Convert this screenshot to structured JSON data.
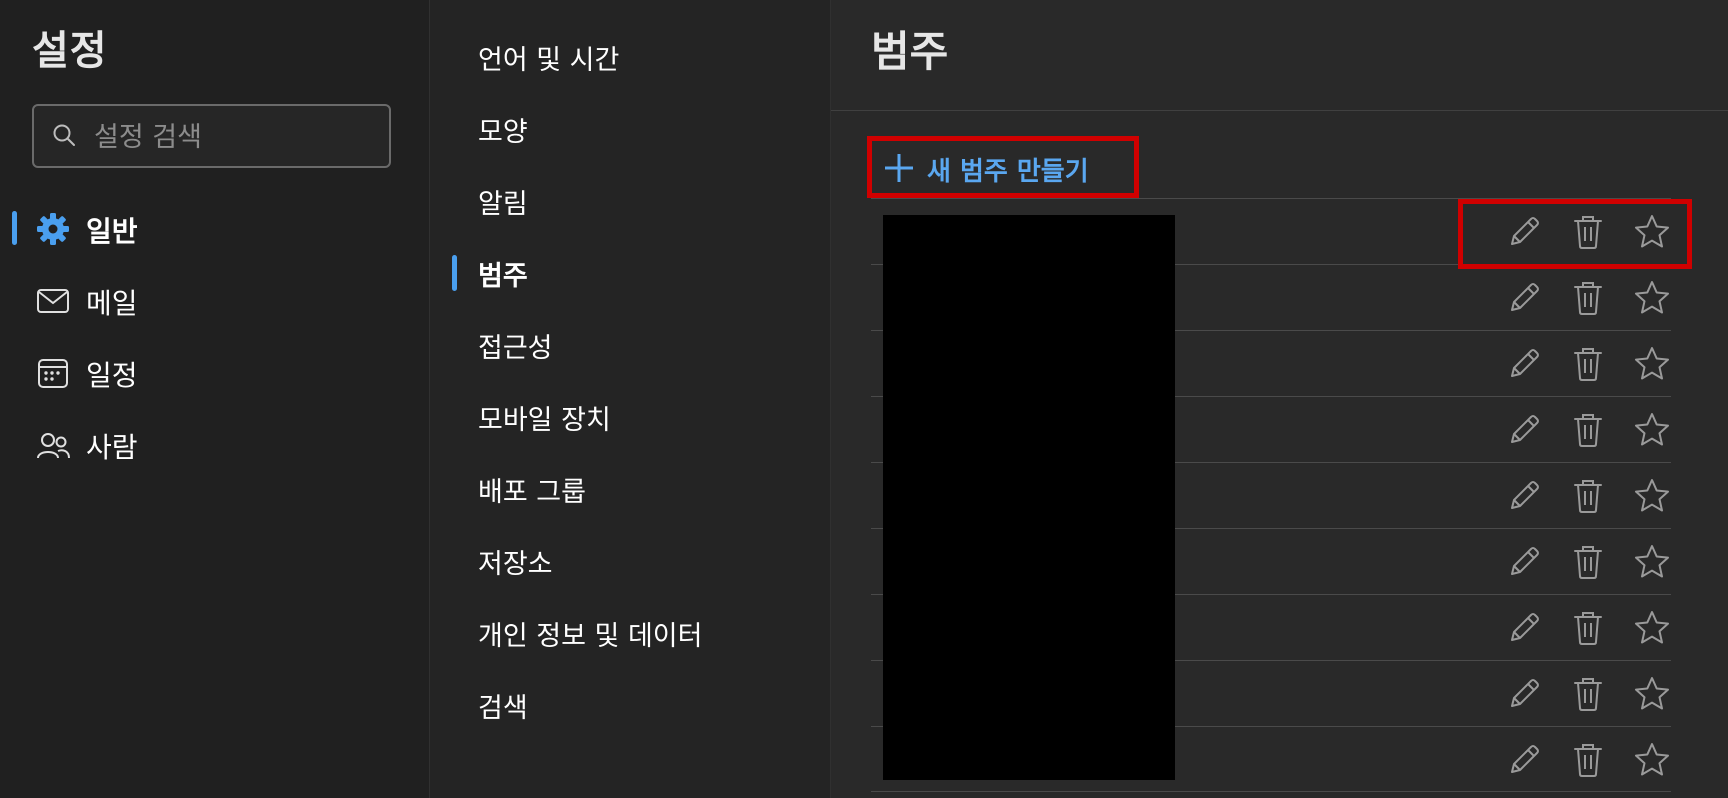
{
  "sidebar": {
    "title": "설정",
    "search": {
      "placeholder": "설정 검색",
      "value": ""
    },
    "items": [
      {
        "label": "일반",
        "icon": "gear-icon",
        "active": true
      },
      {
        "label": "메일",
        "icon": "mail-icon",
        "active": false
      },
      {
        "label": "일정",
        "icon": "calendar-icon",
        "active": false
      },
      {
        "label": "사람",
        "icon": "people-icon",
        "active": false
      }
    ]
  },
  "subnav": {
    "items": [
      {
        "label": "언어 및 시간",
        "active": false
      },
      {
        "label": "모양",
        "active": false
      },
      {
        "label": "알림",
        "active": false
      },
      {
        "label": "범주",
        "active": true
      },
      {
        "label": "접근성",
        "active": false
      },
      {
        "label": "모바일 장치",
        "active": false
      },
      {
        "label": "배포 그룹",
        "active": false
      },
      {
        "label": "저장소",
        "active": false
      },
      {
        "label": "개인 정보 및 데이터",
        "active": false
      },
      {
        "label": "검색",
        "active": false
      }
    ]
  },
  "main": {
    "title": "범주",
    "new_category_label": "새 범주 만들기",
    "category_rows": 9
  },
  "colors": {
    "accent": "#4a9fef",
    "link": "#5aa7f0",
    "highlight": "#d00000",
    "icon_gray": "#9a9a9a"
  }
}
